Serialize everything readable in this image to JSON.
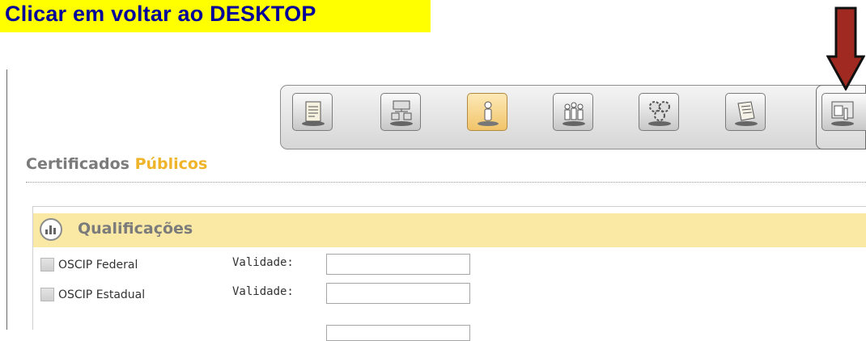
{
  "instruction": {
    "text": "Clicar em voltar ao DESKTOP"
  },
  "toolbar": {
    "buttons": [
      {
        "name": "certificate-icon",
        "active": false
      },
      {
        "name": "org-chart-icon",
        "active": false
      },
      {
        "name": "person-icon",
        "active": true
      },
      {
        "name": "group-icon",
        "active": false
      },
      {
        "name": "gears-icon",
        "active": false
      },
      {
        "name": "scroll-icon",
        "active": false
      }
    ],
    "desktop_button": {
      "name": "desktop-icon"
    }
  },
  "section": {
    "title_part1": "Certificados",
    "title_part2": "Públicos"
  },
  "qualificacoes": {
    "title": "Qualificações",
    "rows": [
      {
        "label": "OSCIP Federal",
        "validity_label": "Validade:",
        "value": ""
      },
      {
        "label": "OSCIP Estadual",
        "validity_label": "Validade:",
        "value": ""
      },
      {
        "label": "",
        "validity_label": "",
        "value": ""
      }
    ]
  },
  "colors": {
    "highlight": "#ffff00",
    "instruction_text": "#00009a",
    "arrow": "#a02a22",
    "accent": "#f0b42a",
    "panel_header": "#f9e9a5"
  }
}
